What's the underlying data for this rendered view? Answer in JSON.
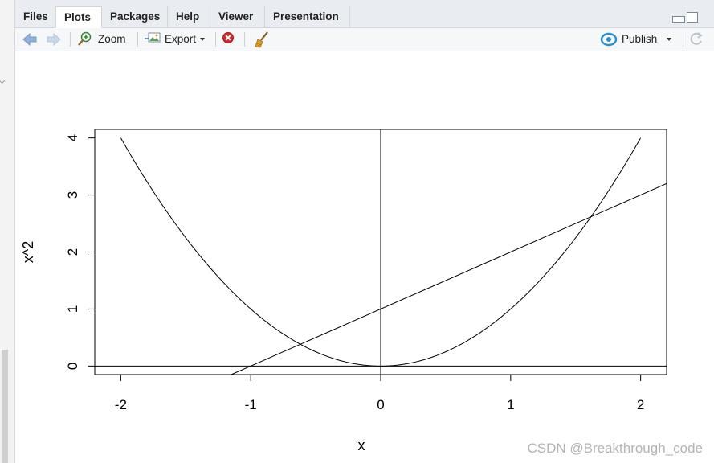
{
  "tabs": [
    {
      "label": "Files"
    },
    {
      "label": "Plots"
    },
    {
      "label": "Packages"
    },
    {
      "label": "Help"
    },
    {
      "label": "Viewer"
    },
    {
      "label": "Presentation"
    }
  ],
  "active_tab": "Plots",
  "toolbar": {
    "zoom_label": "Zoom",
    "export_label": "Export",
    "publish_label": "Publish"
  },
  "watermark": "CSDN @Breakthrough_code",
  "chart_data": {
    "type": "line",
    "title": "",
    "xlabel": "x",
    "ylabel": "x^2",
    "xlim": [
      -2.2,
      2.2
    ],
    "ylim": [
      -0.15,
      4.15
    ],
    "x_ticks": [
      -2,
      -1,
      0,
      1,
      2
    ],
    "y_ticks": [
      0,
      1,
      2,
      3,
      4
    ],
    "grid": false,
    "series": [
      {
        "x": [
          -2,
          -1.75,
          -1.5,
          -1.25,
          -1,
          -0.75,
          -0.5,
          -0.25,
          0,
          0.25,
          0.5,
          0.75,
          1,
          1.25,
          1.5,
          1.75,
          2
        ],
        "y": [
          4,
          3.0625,
          2.25,
          1.5625,
          1,
          0.5625,
          0.25,
          0.0625,
          0,
          0.0625,
          0.25,
          0.5625,
          1,
          1.5625,
          2.25,
          3.0625,
          4
        ]
      },
      {
        "x": [
          -1.15,
          2.2
        ],
        "y": [
          -0.15,
          3.2
        ]
      }
    ],
    "reference_lines": [
      {
        "orientation": "horizontal",
        "value": 0
      },
      {
        "orientation": "vertical",
        "value": 0
      }
    ],
    "line_color": "#000000"
  }
}
